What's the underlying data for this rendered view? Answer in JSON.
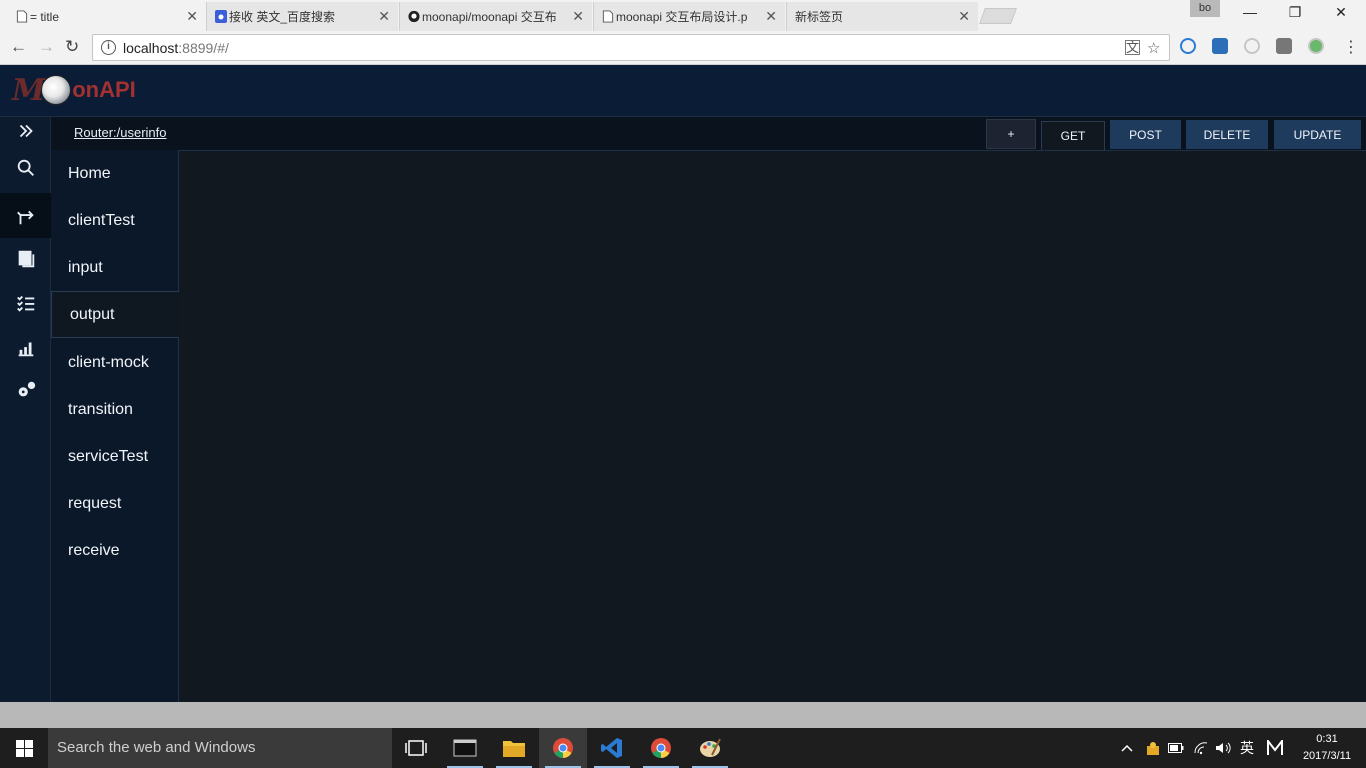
{
  "browser": {
    "tabs": [
      {
        "title": "= title",
        "active": true
      },
      {
        "title": "接收 英文_百度搜索",
        "active": false
      },
      {
        "title": "moonapi/moonapi 交互布",
        "active": false
      },
      {
        "title": "moonapi 交互布局设计.p",
        "active": false
      },
      {
        "title": "新标签页",
        "active": false
      }
    ],
    "profile_label": "bo",
    "url_host": "localhost",
    "url_rest": ":8899/#/"
  },
  "app": {
    "logo": {
      "letter": "M",
      "text": "onAPI"
    },
    "router_link": "Router:/userinfo",
    "buttons": {
      "add": "+",
      "get": "GET",
      "post": "POST",
      "delete": "DELETE",
      "update": "UPDATE"
    },
    "rail_icons": [
      "expand-icon",
      "search-icon",
      "routes-icon",
      "document-icon",
      "checklist-icon",
      "chart-icon",
      "settings-icon"
    ],
    "active_rail_index": 2,
    "menu": [
      {
        "label": "Home"
      },
      {
        "label": "clientTest"
      },
      {
        "label": "input"
      },
      {
        "label": "output"
      },
      {
        "label": "client-mock"
      },
      {
        "label": "transition"
      },
      {
        "label": "serviceTest"
      },
      {
        "label": "request"
      },
      {
        "label": "receive"
      }
    ],
    "active_menu_index": 3
  },
  "taskbar": {
    "search_placeholder": "Search the web and Windows",
    "ime_label": "英",
    "time": "0:31",
    "date": "2017/3/11"
  },
  "colors": {
    "header_bg": "#0b1d36",
    "method_btn": "#1e3a5c",
    "logo_red": "#a33131"
  }
}
